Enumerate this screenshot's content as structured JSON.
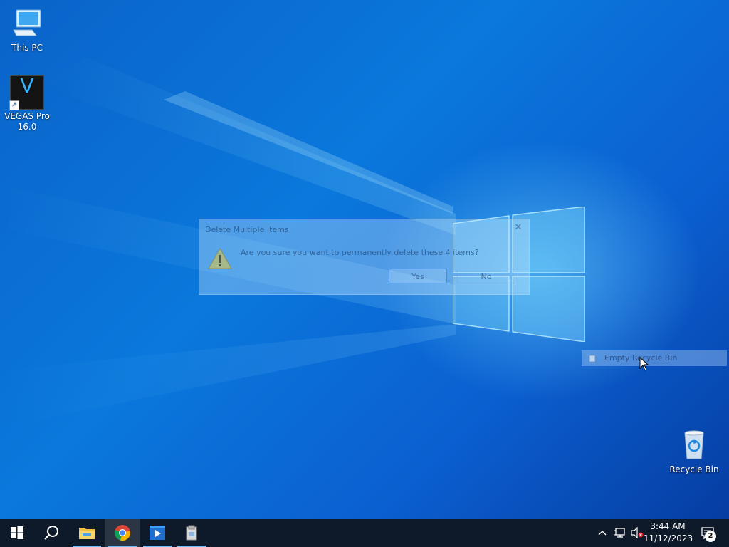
{
  "desktop": {
    "icons": [
      {
        "label": "This PC"
      },
      {
        "label": "VEGAS Pro 16.0",
        "glyph": "V"
      },
      {
        "label": "Recycle Bin"
      }
    ]
  },
  "dialog": {
    "title": "Delete Multiple Items",
    "message": "Are you sure you want to permanently delete these 4 items?",
    "yes_label": "Yes",
    "no_label": "No",
    "close_glyph": "✕"
  },
  "context_menu": {
    "item": "Empty Recycle Bin"
  },
  "taskbar": {
    "pinned": [
      "start-icon",
      "search-icon",
      "file-explorer-icon",
      "chrome-icon",
      "media-player-icon",
      "installer-icon"
    ],
    "clock_time": "3:44 AM",
    "clock_date": "11/12/2023",
    "notification_count": "2",
    "accent_color": "#76b9ed"
  }
}
